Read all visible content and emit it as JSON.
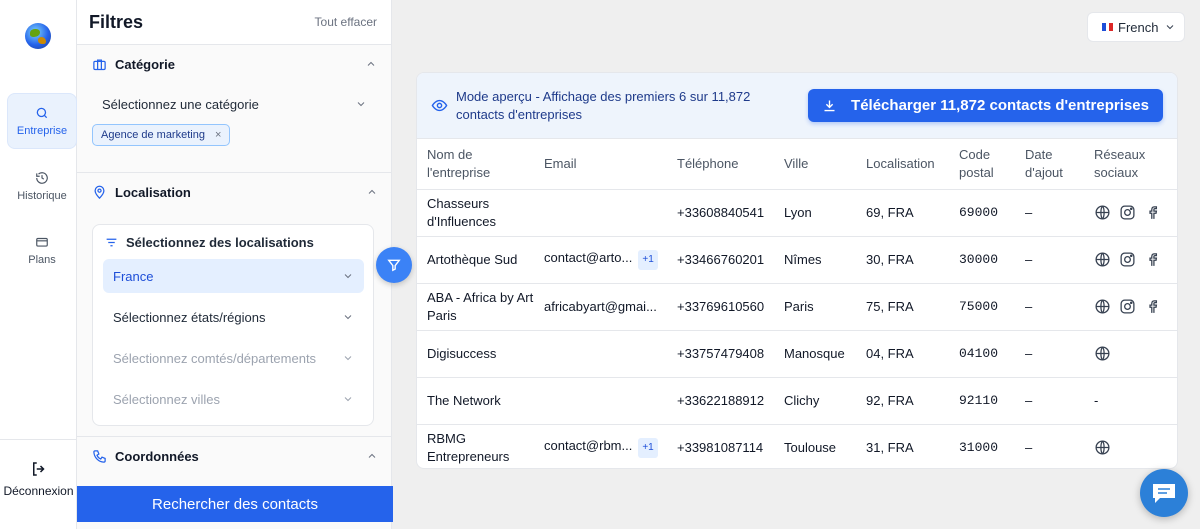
{
  "rail": {
    "items": [
      {
        "label": "Entreprise",
        "icon": "search-icon"
      },
      {
        "label": "Historique",
        "icon": "history-icon"
      },
      {
        "label": "Plans",
        "icon": "credit-card-icon"
      }
    ],
    "logout": "Déconnexion"
  },
  "filters": {
    "title": "Filtres",
    "clear_all": "Tout effacer",
    "category": {
      "title": "Catégorie",
      "select_placeholder": "Sélectionnez une catégorie",
      "chip": "Agence de marketing"
    },
    "location": {
      "title": "Localisation",
      "box_title": "Sélectionnez des localisations",
      "country": "France",
      "states": "Sélectionnez états/régions",
      "counties": "Sélectionnez comtés/départements",
      "cities": "Sélectionnez villes"
    },
    "contacts": {
      "title": "Coordonnées"
    },
    "search_button": "Rechercher des contacts"
  },
  "language": {
    "label": "French"
  },
  "banner": {
    "text": "Mode aperçu - Affichage des premiers 6 sur 11,872 contacts d'entreprises",
    "download_button": "Télécharger 11,872 contacts d'entreprises"
  },
  "table": {
    "headers": [
      "Nom de l'entreprise",
      "Email",
      "Téléphone",
      "Ville",
      "Localisation",
      "Code postal",
      "Date d'ajout",
      "Réseaux sociaux"
    ],
    "rows": [
      {
        "name": "Chasseurs d'Influences",
        "email": "",
        "extra": "",
        "phone": "+33608840541",
        "city": "Lyon",
        "loc": "69, FRA",
        "zip": "69000",
        "date": "–",
        "social": [
          "web",
          "instagram",
          "facebook"
        ]
      },
      {
        "name": "Artothèque Sud",
        "email": "contact@arto...",
        "extra": "+1",
        "phone": "+33466760201",
        "city": "Nîmes",
        "loc": "30, FRA",
        "zip": "30000",
        "date": "–",
        "social": [
          "web",
          "instagram",
          "facebook"
        ]
      },
      {
        "name": "ABA - Africa by Art Paris",
        "email": "africabyart@gmai...",
        "extra": "",
        "phone": "+33769610560",
        "city": "Paris",
        "loc": "75, FRA",
        "zip": "75000",
        "date": "–",
        "social": [
          "web",
          "instagram",
          "facebook"
        ]
      },
      {
        "name": "Digisuccess",
        "email": "",
        "extra": "",
        "phone": "+33757479408",
        "city": "Manosque",
        "loc": "04, FRA",
        "zip": "04100",
        "date": "–",
        "social": [
          "web"
        ]
      },
      {
        "name": "The Network",
        "email": "",
        "extra": "",
        "phone": "+33622188912",
        "city": "Clichy",
        "loc": "92, FRA",
        "zip": "92110",
        "date": "–",
        "social_text": "-",
        "social": []
      },
      {
        "name": "RBMG Entrepreneurs",
        "email": "contact@rbm...",
        "extra": "+1",
        "phone": "+33981087114",
        "city": "Toulouse",
        "loc": "31, FRA",
        "zip": "31000",
        "date": "–",
        "social": [
          "web"
        ]
      }
    ]
  },
  "colors": {
    "accent": "#2563eb",
    "banner_bg": "#eef4fc"
  }
}
